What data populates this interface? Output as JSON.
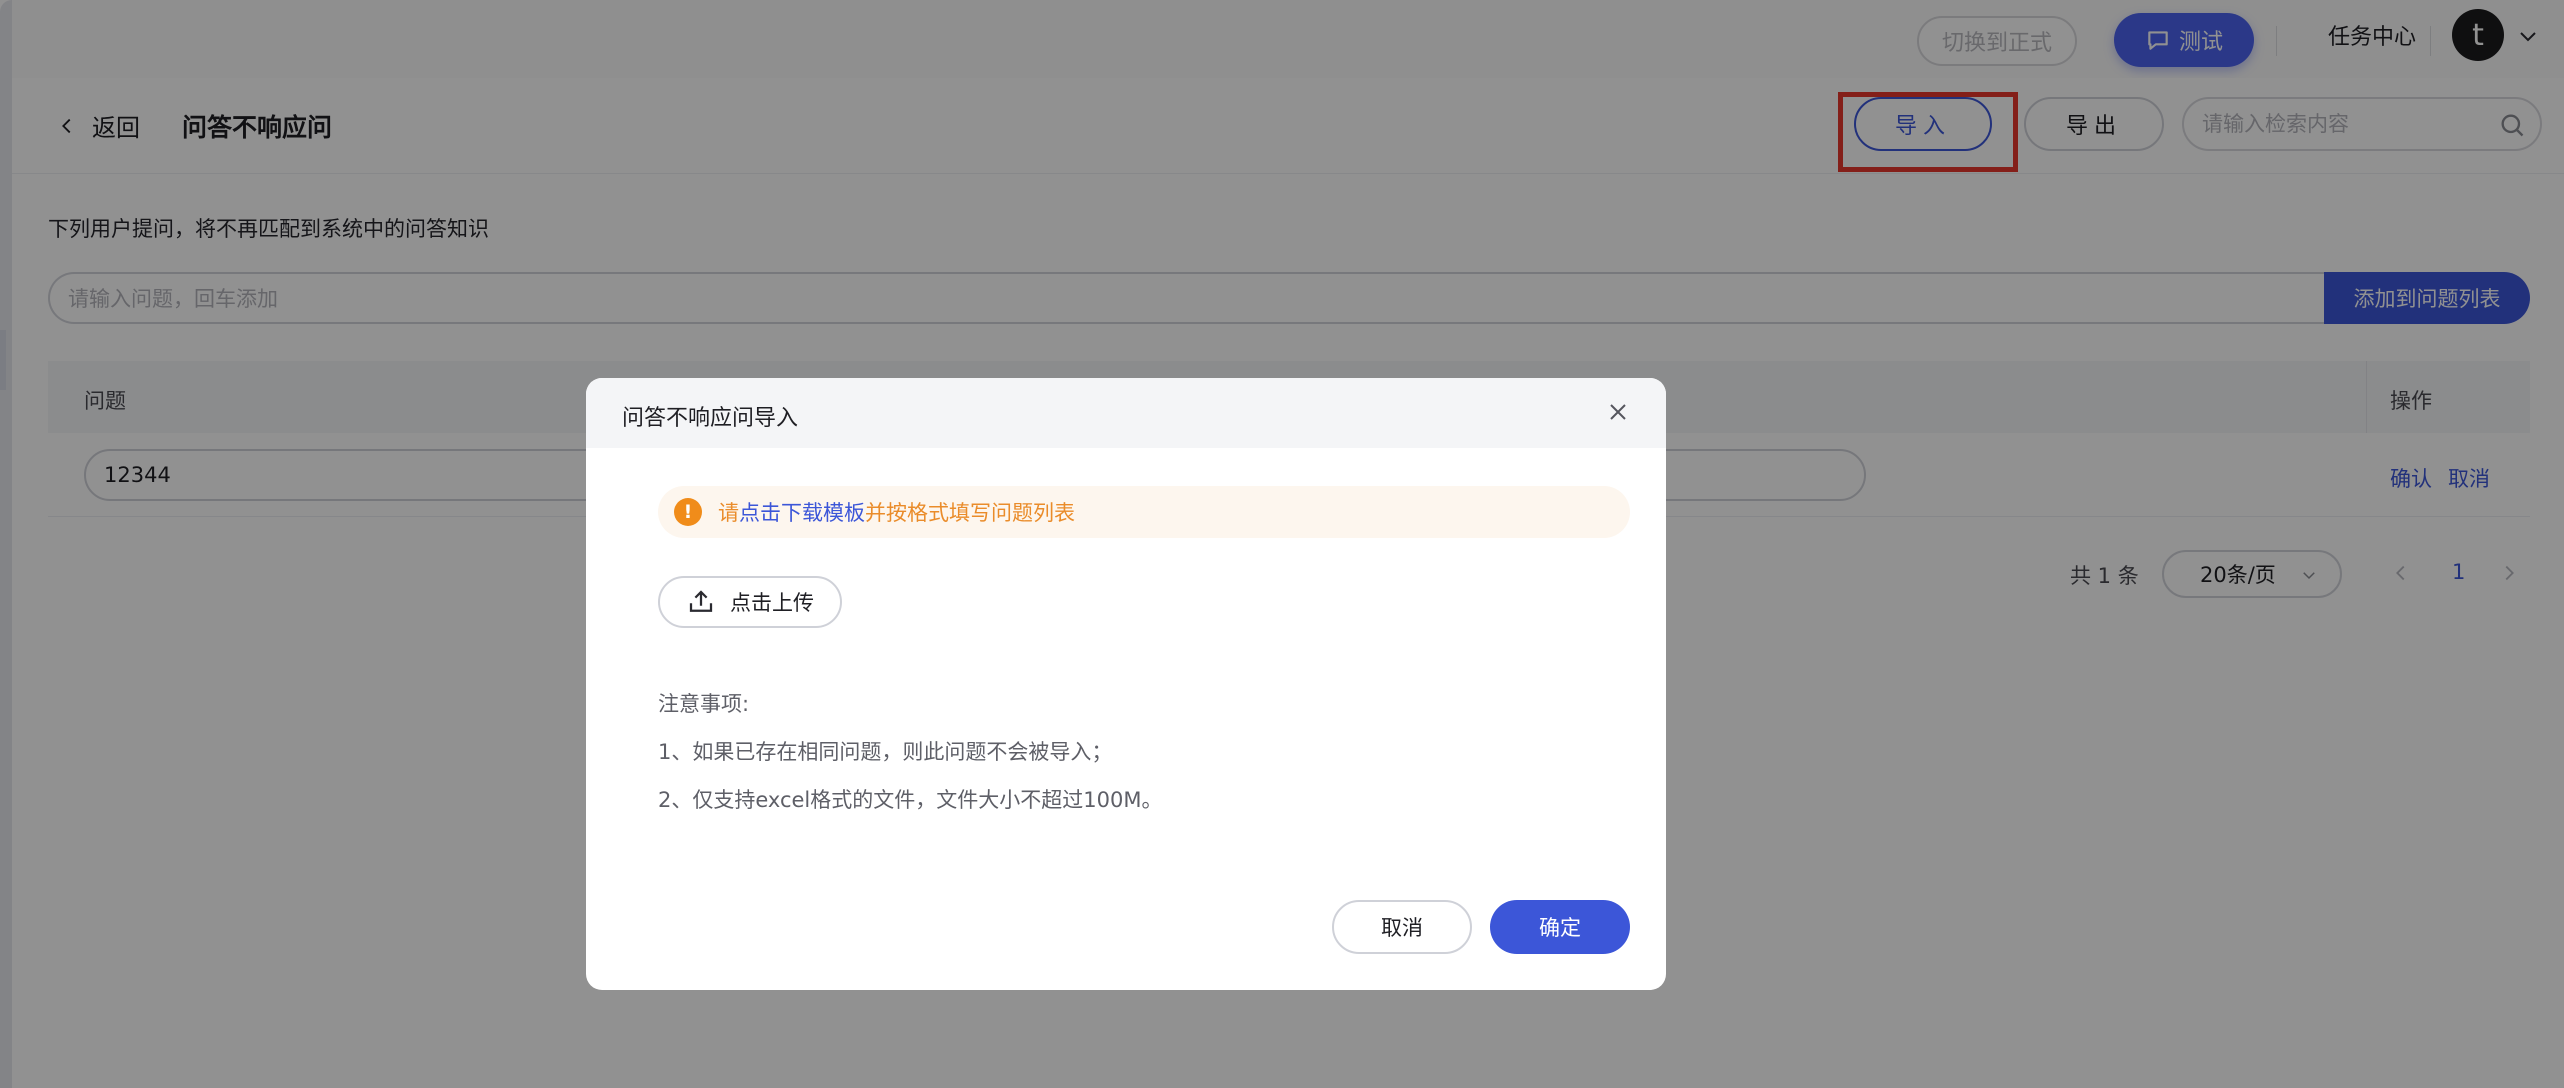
{
  "topbar": {
    "switch_label": "切换到正式",
    "test_label": "测试",
    "task_center_label": "任务中心",
    "avatar_initial": "t"
  },
  "header": {
    "back_label": "返回",
    "title": "问答不响应问",
    "import_label": "导入",
    "export_label": "导出",
    "search_placeholder": "请输入检索内容"
  },
  "content": {
    "description": "下列用户提问，将不再匹配到系统中的问答知识",
    "add_placeholder": "请输入问题，回车添加",
    "add_button_label": "添加到问题列表",
    "table": {
      "columns": [
        "问题",
        "操作"
      ],
      "rows": [
        {
          "question": "12344",
          "confirm_label": "确认",
          "cancel_label": "取消"
        }
      ]
    },
    "pagination": {
      "total_label": "共 1 条",
      "page_size_label": "20条/页",
      "current_page": "1"
    }
  },
  "modal": {
    "title": "问答不响应问导入",
    "notice_prefix": "请",
    "notice_link": "点击下载模板",
    "notice_suffix": "并按格式填写问题列表",
    "upload_label": "点击上传",
    "notes_title": "注意事项:",
    "notes": [
      "1、如果已存在相同问题，则此问题不会被导入；",
      "2、仅支持excel格式的文件，文件大小不超过100M。"
    ],
    "cancel_label": "取消",
    "ok_label": "确定"
  },
  "colors": {
    "primary": "#3c56d8",
    "test_button": "#4c63f0",
    "warning": "#f08c1a",
    "highlight": "#e8382c"
  }
}
